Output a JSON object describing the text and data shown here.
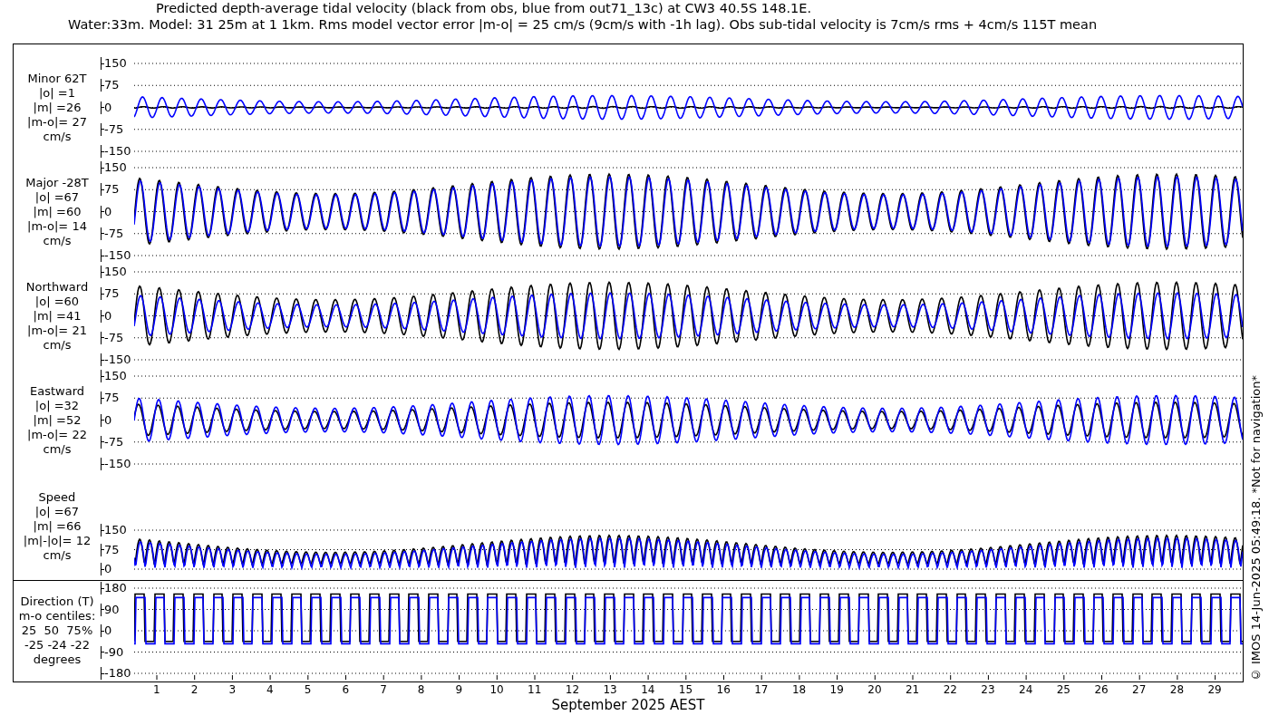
{
  "title": {
    "lines": [
      "Predicted depth-average tidal velocity (black from obs, blue from out71_13c) at CW3 40.5S 148.1E.",
      "Water:33m. Model: 31 25m at 1 1km. Rms model vector error |m-o| = 25 cm/s (9cm/s with -1h lag). Obs sub-tidal velocity is 7cm/s rms + 4cm/s 115T mean"
    ]
  },
  "panels": [
    {
      "kind": "signed",
      "label_lines": [
        "Minor 62T",
        "|o| =1",
        "|m| =26",
        "|m-o|= 27",
        "cm/s"
      ],
      "y_ticks": [
        "150",
        "75",
        "0",
        "-75",
        "-150"
      ]
    },
    {
      "kind": "signed",
      "label_lines": [
        "Major -28T",
        "|o| =67",
        "|m| =60",
        "|m-o|= 14",
        "cm/s"
      ],
      "y_ticks": [
        "150",
        "75",
        "0",
        "-75",
        "-150"
      ]
    },
    {
      "kind": "signed",
      "label_lines": [
        "Northward",
        "|o| =60",
        "|m| =41",
        "|m-o|= 21",
        "cm/s"
      ],
      "y_ticks": [
        "150",
        "75",
        "0",
        "-75",
        "-150"
      ]
    },
    {
      "kind": "signed",
      "label_lines": [
        "Eastward",
        "|o| =32",
        "|m| =52",
        "|m-o|= 22",
        "cm/s"
      ],
      "y_ticks": [
        "150",
        "75",
        "0",
        "-75",
        "-150"
      ]
    },
    {
      "kind": "speed",
      "label_lines": [
        "Speed",
        "|o| =67",
        "|m| =66",
        "|m|-|o|= 12",
        "cm/s"
      ],
      "y_ticks": [
        "150",
        "75",
        "0"
      ]
    }
  ],
  "direction_panel": {
    "label_lines": [
      "Direction (T)",
      "m-o centiles:",
      "25  50  75%",
      "-25 -24 -22",
      "degrees"
    ],
    "y_ticks": [
      "180",
      "90",
      "0",
      "-90",
      "-180"
    ]
  },
  "x_axis": {
    "ticks": [
      "1",
      "2",
      "3",
      "4",
      "5",
      "6",
      "7",
      "8",
      "9",
      "10",
      "11",
      "12",
      "13",
      "14",
      "15",
      "16",
      "17",
      "18",
      "19",
      "20",
      "21",
      "22",
      "23",
      "24",
      "25",
      "26",
      "27",
      "28",
      "29"
    ],
    "label": "September 2025 AEST"
  },
  "credit": "© IMOS 14-Jun-2025 05:49:18. *Not for navigation*"
}
